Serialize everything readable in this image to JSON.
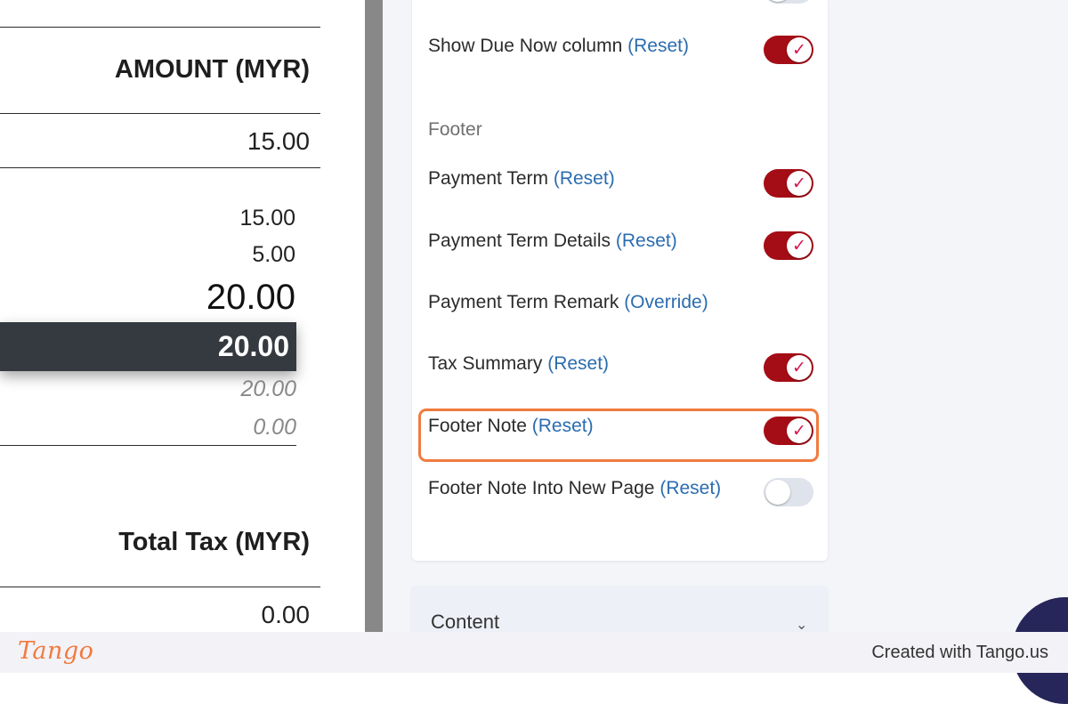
{
  "invoice": {
    "amount_header": "AMOUNT (MYR)",
    "line_amount": "15.00",
    "subtotal": "15.00",
    "tax": "5.00",
    "total": "20.00",
    "total_highlight": "20.00",
    "paid": "20.00",
    "balance": "0.00",
    "total_tax_header": "Total Tax (MYR)",
    "total_tax_value": "0.00"
  },
  "settings": {
    "top_row": {
      "label": "Show Due Now column",
      "link": "(Reset)",
      "enabled": true
    },
    "footer_section": "Footer",
    "rows": [
      {
        "label": "Payment Term",
        "link": "(Reset)",
        "enabled": true
      },
      {
        "label": "Payment Term Details",
        "link": "(Reset)",
        "enabled": true
      },
      {
        "label": "Payment Term Remark",
        "link": "(Override)"
      },
      {
        "label": "Tax Summary",
        "link": "(Reset)",
        "enabled": true
      },
      {
        "label": "Footer Note",
        "link": "(Reset)",
        "enabled": true
      },
      {
        "label": "Footer Note Into New Page",
        "link": "(Reset)",
        "enabled": false
      }
    ],
    "content_section": "Content"
  },
  "icons": {
    "toggle_check": "check-icon",
    "content_chevron": "chevron-down-icon"
  },
  "colors": {
    "toggle_on": "#a50d16",
    "toggle_off": "#dfe3eb",
    "check": "#d6144d",
    "link": "#2b6cb0",
    "highlight": "#f07b3f",
    "dark_bar": "#343a40"
  },
  "footer": {
    "logo": "Tango",
    "created_with": "Created with Tango.us"
  }
}
